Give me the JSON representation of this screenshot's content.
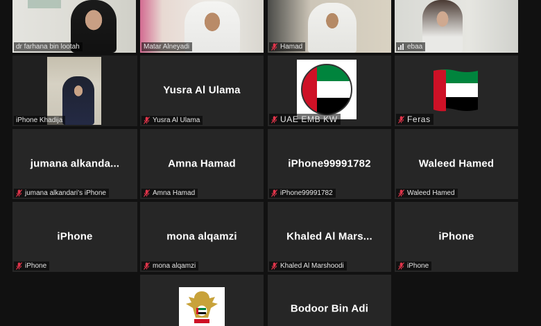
{
  "participants": [
    {
      "id": "p1",
      "name": "dr farhana bin lootah",
      "type": "video",
      "mic": "none"
    },
    {
      "id": "p2",
      "name": "Matar Alneyadi",
      "type": "video",
      "mic": "none"
    },
    {
      "id": "p3",
      "name": "Hamad",
      "type": "video",
      "mic": "muted"
    },
    {
      "id": "p4",
      "name": "ebaa",
      "type": "video",
      "mic": "active"
    },
    {
      "id": "p5",
      "name": "iPhone Khadija",
      "type": "video",
      "mic": "none",
      "active_speaker": true
    },
    {
      "id": "p6",
      "name": "Yusra Al Ulama",
      "display": "Yusra Al Ulama",
      "type": "name",
      "mic": "muted"
    },
    {
      "id": "p7",
      "name": "UAE EMB KW",
      "type": "flag",
      "mic": "muted"
    },
    {
      "id": "p8",
      "name": "Feras",
      "type": "flag",
      "mic": "muted"
    },
    {
      "id": "p9",
      "name": "jumana alkandari's iPhone",
      "display": "jumana alkanda...",
      "type": "name",
      "mic": "muted"
    },
    {
      "id": "p10",
      "name": "Amna Hamad",
      "display": "Amna Hamad",
      "type": "name",
      "mic": "muted"
    },
    {
      "id": "p11",
      "name": "iPhone99991782",
      "display": "iPhone99991782",
      "type": "name",
      "mic": "muted"
    },
    {
      "id": "p12",
      "name": "Waleed Hamed",
      "display": "Waleed Hamed",
      "type": "name",
      "mic": "muted"
    },
    {
      "id": "p13",
      "name": "iPhone",
      "display": "iPhone",
      "type": "name",
      "mic": "muted"
    },
    {
      "id": "p14",
      "name": "mona alqamzi",
      "display": "mona alqamzi",
      "type": "name",
      "mic": "muted"
    },
    {
      "id": "p15",
      "name": "Khaled Al Marshoodi",
      "display": "Khaled Al Mars...",
      "type": "name",
      "mic": "muted"
    },
    {
      "id": "p16",
      "name": "iPhone",
      "display": "iPhone",
      "type": "name",
      "mic": "muted"
    },
    {
      "id": "p17",
      "type": "emblem"
    },
    {
      "id": "p18",
      "display": "Bodoor Bin Adi",
      "type": "name"
    }
  ],
  "colors": {
    "tile_bg": "#262626",
    "page_bg": "#111111",
    "active_border": "#c9dd3a",
    "muted_mic": "#e0344a",
    "flag_green": "#00843d",
    "flag_red": "#ce1126",
    "flag_black": "#000000",
    "flag_white": "#ffffff"
  },
  "icons": {
    "muted": "mic-muted-icon",
    "active": "audio-level-icon"
  }
}
